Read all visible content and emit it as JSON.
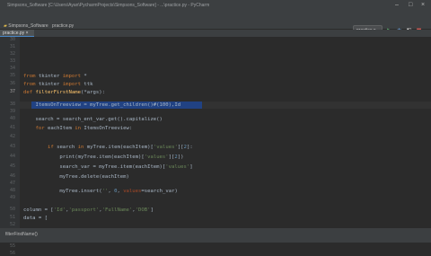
{
  "titlebar": {
    "title": "Simpsons_Software [C:\\Users\\Ayan\\PycharmProjects\\Simpsons_Software] - ...\\practice.py - PyCharm"
  },
  "breadcrumbs": {
    "project": "Simpsons_Software",
    "file": "practice.py"
  },
  "toolbar": {
    "run_config": "practice"
  },
  "editor_tab": {
    "label": "practice.py"
  },
  "gutter": {
    "lines": [
      "30",
      "31",
      "32",
      "33",
      "34",
      "35",
      "36",
      "37",
      "38",
      "39",
      "40",
      "41",
      "42",
      "43",
      "44",
      "45",
      "46",
      "47",
      "48",
      "49",
      "50",
      "51",
      "52",
      "53",
      "54",
      "55",
      "56"
    ]
  },
  "code": {
    "l1": "from tkinter import *",
    "l2": "from tkinter import ttk",
    "l3": "def filterFirstName(*args):",
    "l4": "    ItemsOnTreeview = myTree.get_children()#(100),Id",
    "l5": "    search = search_ent_var.get().capitalize()",
    "l6": "    for eachItem in ItemsOnTreeview:",
    "l7": "        if search in myTree.item(eachItem)['values'][2]:",
    "l8": "            print(myTree.item(eachItem)['values'][2])",
    "l9": "            search_var = myTree.item(eachItem)['values']",
    "l10": "            myTree.delete(eachItem)",
    "l11": "            myTree.insert('', 0, values=search_var)",
    "l12": "column = ['Id','passport','FullName','DOB']",
    "l13": "data = ["
  },
  "statusbar": {
    "text": "filterFirstName()"
  }
}
